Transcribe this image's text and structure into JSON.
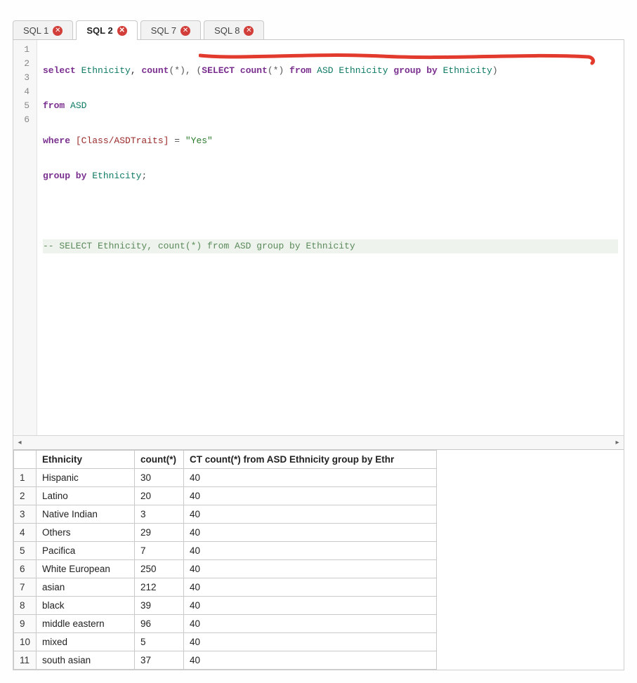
{
  "tabs": [
    {
      "label": "SQL 1",
      "active": false
    },
    {
      "label": "SQL 2",
      "active": true
    },
    {
      "label": "SQL 7",
      "active": false
    },
    {
      "label": "SQL 8",
      "active": false
    }
  ],
  "editor": {
    "line_count": 6,
    "line1": {
      "t0": "select ",
      "t1": "Ethnicity",
      "t2": ", ",
      "t3": "count",
      "t4": "(",
      "t5": "*",
      "t6": "), (",
      "t7": "SELECT ",
      "t8": "count",
      "t9": "(",
      "t10": "*",
      "t11": ") ",
      "t12": "from ",
      "t13": "ASD ",
      "t14": "Ethnicity ",
      "t15": "group by ",
      "t16": "Ethnicity",
      "t17": ")"
    },
    "line2": {
      "t0": "from ",
      "t1": "ASD"
    },
    "line3": {
      "t0": "where ",
      "t1": "[Class/ASDTraits]",
      "t2": " = ",
      "t3": "\"Yes\""
    },
    "line4": {
      "t0": "group by ",
      "t1": "Ethnicity",
      "t2": ";"
    },
    "line5": {
      "t0": ""
    },
    "line6": {
      "t0": "-- SELECT Ethnicity, count(*) from ASD group by Ethnicity"
    }
  },
  "results": {
    "headers": {
      "c0": "",
      "c1": "Ethnicity",
      "c2": "count(*)",
      "c3": "CT count(*) from ASD Ethnicity group by Ethr"
    },
    "rows": [
      {
        "n": "1",
        "eth": "Hispanic",
        "cnt": "30",
        "ct": "40"
      },
      {
        "n": "2",
        "eth": "Latino",
        "cnt": "20",
        "ct": "40"
      },
      {
        "n": "3",
        "eth": "Native Indian",
        "cnt": "3",
        "ct": "40"
      },
      {
        "n": "4",
        "eth": "Others",
        "cnt": "29",
        "ct": "40"
      },
      {
        "n": "5",
        "eth": "Pacifica",
        "cnt": "7",
        "ct": "40"
      },
      {
        "n": "6",
        "eth": "White European",
        "cnt": "250",
        "ct": "40"
      },
      {
        "n": "7",
        "eth": "asian",
        "cnt": "212",
        "ct": "40"
      },
      {
        "n": "8",
        "eth": "black",
        "cnt": "39",
        "ct": "40"
      },
      {
        "n": "9",
        "eth": "middle eastern",
        "cnt": "96",
        "ct": "40"
      },
      {
        "n": "10",
        "eth": "mixed",
        "cnt": "5",
        "ct": "40"
      },
      {
        "n": "11",
        "eth": "south asian",
        "cnt": "37",
        "ct": "40"
      }
    ]
  }
}
